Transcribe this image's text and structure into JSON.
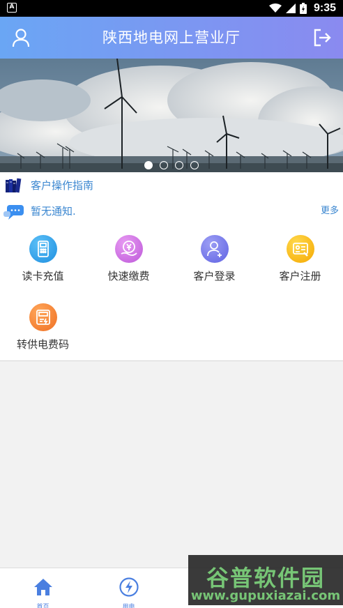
{
  "status_bar": {
    "time": "9:35",
    "left_icon": "A"
  },
  "header": {
    "title": "陕西地电网上营业厅",
    "left_icon": "user-icon",
    "right_icon": "logout-icon"
  },
  "banner": {
    "image": "wind-turbines-under-clouds",
    "slide_count": 4,
    "active_slide": 1
  },
  "guide": {
    "label": "客户操作指南",
    "icon": "books-icon"
  },
  "notice": {
    "label": "暂无通知.",
    "more_label": "更多",
    "icon": "chat-bubble-icon"
  },
  "menu": {
    "items": [
      {
        "label": "读卡充值",
        "icon": "card-reader-icon",
        "color": "#1e9be8"
      },
      {
        "label": "快速缴费",
        "icon": "yuan-pay-icon",
        "color": "#c46adf"
      },
      {
        "label": "客户登录",
        "icon": "user-add-icon",
        "color": "#6f73ea"
      },
      {
        "label": "客户注册",
        "icon": "id-card-icon",
        "color": "#f7b000"
      },
      {
        "label": "转供电费码",
        "icon": "meter-icon",
        "color": "#f27a2e"
      }
    ]
  },
  "bottom_nav": {
    "items": [
      {
        "label": "首页",
        "icon": "home-icon"
      },
      {
        "label": "用电",
        "icon": "lightning-icon"
      }
    ]
  },
  "watermark": {
    "title": "谷普软件园",
    "url": "www.gupuxiazai.com"
  }
}
